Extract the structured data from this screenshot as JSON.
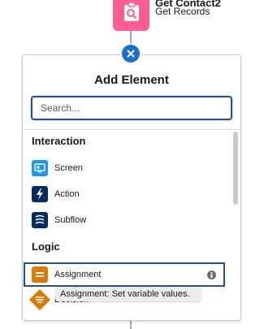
{
  "node": {
    "title": "Get Contact2",
    "subtitle": "Get Records",
    "icon": "clipboard-search-icon",
    "color": "#ff5d8f"
  },
  "panel": {
    "title": "Add Element",
    "search_placeholder": "Search...",
    "accent": "#1b5297"
  },
  "sections": [
    {
      "heading": "Interaction",
      "items": [
        {
          "label": "Screen",
          "icon": "screen-icon",
          "color": "#1b96ff"
        },
        {
          "label": "Action",
          "icon": "lightning-bolt-icon",
          "color": "#032d60"
        },
        {
          "label": "Subflow",
          "icon": "subflow-icon",
          "color": "#032d60"
        }
      ]
    },
    {
      "heading": "Logic",
      "items": [
        {
          "label": "Assignment",
          "icon": "assignment-icon",
          "color": "#dd7a01",
          "selected": true
        },
        {
          "label": "Decision",
          "icon": "decision-icon",
          "color": "#dd7a01"
        }
      ]
    }
  ],
  "tooltip": "Assignment: Set variable values."
}
